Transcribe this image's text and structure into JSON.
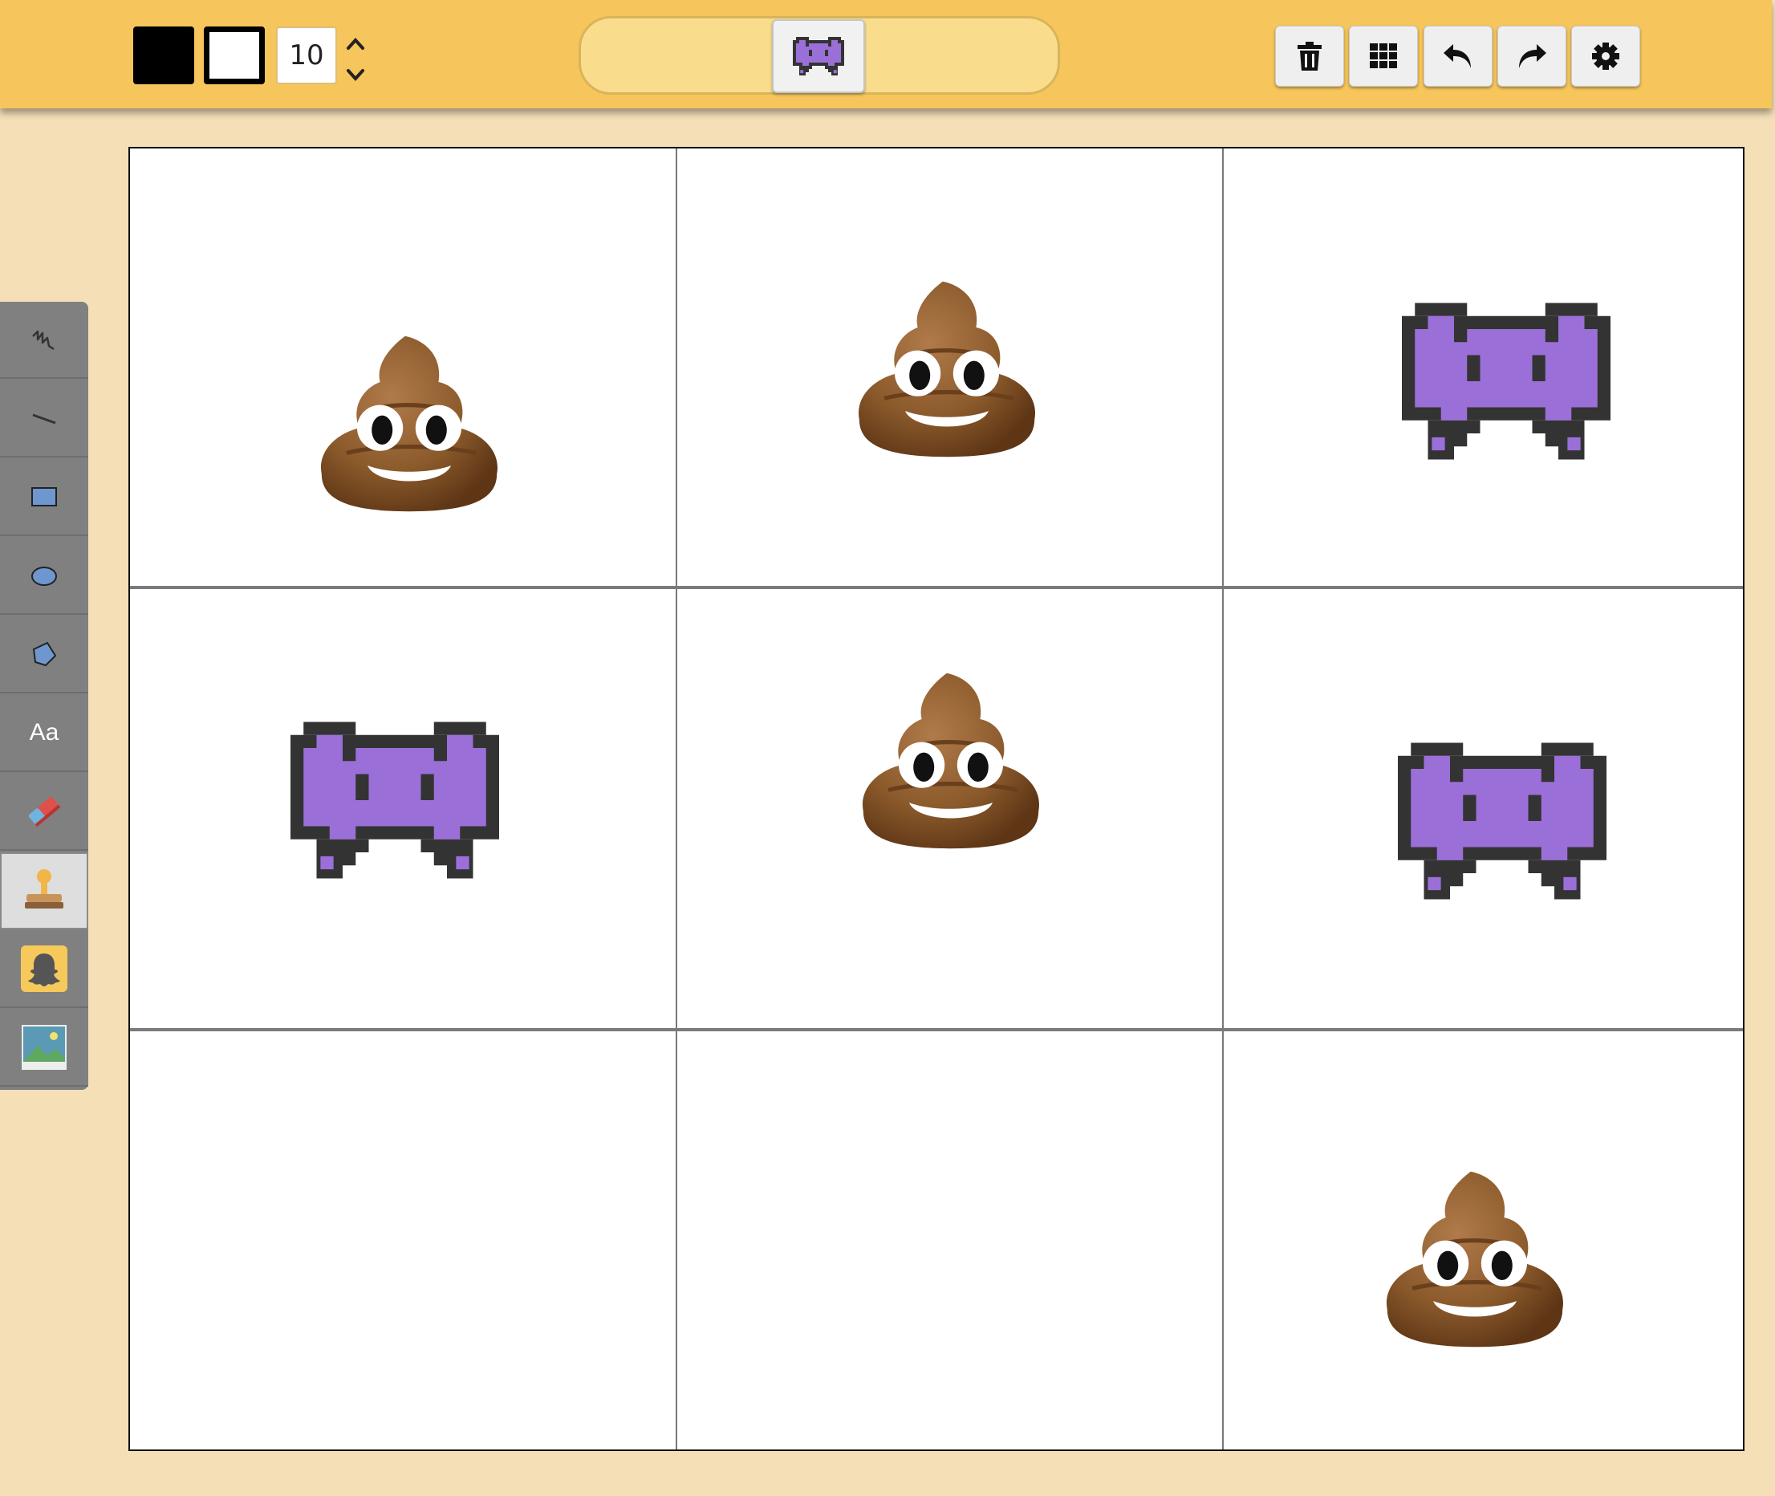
{
  "toolbar": {
    "foreground_color": "#000000",
    "background_color": "#ffffff",
    "stroke_size": "10",
    "selected_stamp_icon": "alien-monster-icon",
    "actions": [
      "trash-icon",
      "grid-icon",
      "undo-icon",
      "redo-icon",
      "gear-icon"
    ]
  },
  "sidebar": {
    "tools": [
      {
        "name": "freehand",
        "icon": "scribble-icon"
      },
      {
        "name": "line",
        "icon": "line-icon"
      },
      {
        "name": "rectangle",
        "icon": "rectangle-icon"
      },
      {
        "name": "ellipse",
        "icon": "ellipse-icon"
      },
      {
        "name": "polygon",
        "icon": "polygon-icon"
      },
      {
        "name": "text",
        "label": "Aa"
      },
      {
        "name": "eraser",
        "icon": "eraser-icon"
      },
      {
        "name": "stamp",
        "icon": "stamp-icon",
        "active": true
      },
      {
        "name": "snapchat",
        "icon": "ghost-icon"
      },
      {
        "name": "image",
        "icon": "image-icon"
      }
    ]
  },
  "canvas": {
    "grid": "3x3",
    "cells": [
      [
        "pile-of-poo",
        "pile-of-poo",
        "alien-monster"
      ],
      [
        "alien-monster",
        "pile-of-poo",
        "alien-monster"
      ],
      [
        "",
        "",
        "pile-of-poo"
      ]
    ]
  },
  "colors": {
    "toolbar_bg": "#f6c55b",
    "page_bg": "#f4dfb7",
    "sidebar_bg": "#808080",
    "poo_brown": "#8b5a2b",
    "alien_purple": "#9b6fd8"
  }
}
